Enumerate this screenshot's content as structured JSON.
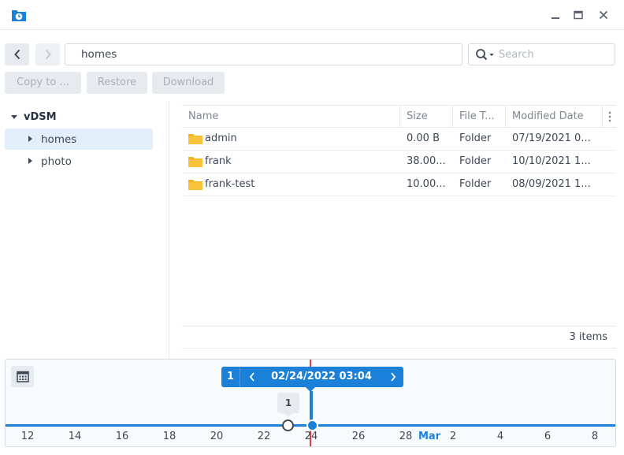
{
  "window": {
    "app_icon": "hyper-backup-vault-icon",
    "controls": [
      "minimize-icon",
      "maximize-icon",
      "close-icon"
    ]
  },
  "toolbar": {
    "path": "homes",
    "search_placeholder": "Search",
    "copy_label": "Copy to ...",
    "restore_label": "Restore",
    "download_label": "Download"
  },
  "tree": {
    "root": "vDSM",
    "items": [
      {
        "label": "homes",
        "selected": true
      },
      {
        "label": "photo",
        "selected": false
      }
    ]
  },
  "table": {
    "columns": [
      "Name",
      "Size",
      "File T...",
      "Modified Date"
    ],
    "rows": [
      {
        "name": "admin",
        "size": "0.00 B",
        "type": "Folder",
        "modified": "07/19/2021 0..."
      },
      {
        "name": "frank",
        "size": "38.00...",
        "type": "Folder",
        "modified": "10/10/2021 1..."
      },
      {
        "name": "frank-test",
        "size": "10.00...",
        "type": "Folder",
        "modified": "08/09/2021 1..."
      }
    ],
    "item_count": "3 items"
  },
  "timeline": {
    "version_count": "1",
    "datetime": "02/24/2022 03:04",
    "bubble_count": "1",
    "ticks": [
      "12",
      "14",
      "16",
      "18",
      "20",
      "22",
      "24",
      "26",
      "28",
      "Mar",
      "2",
      "4",
      "6",
      "8"
    ],
    "month_tick": "Mar"
  },
  "colors": {
    "accent": "#1a80d8",
    "current_time_line": "#e0403f",
    "folder": "#f5b21b"
  }
}
